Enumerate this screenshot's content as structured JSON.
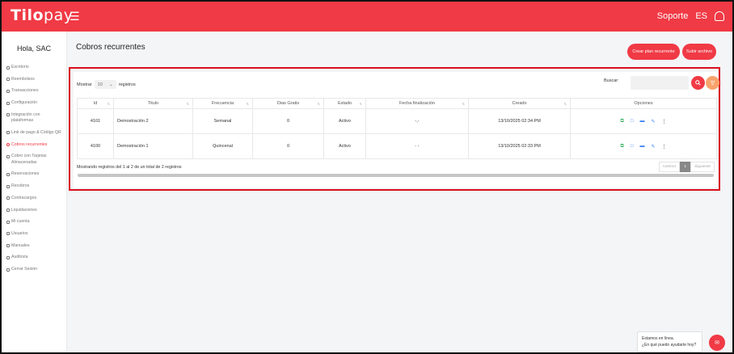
{
  "topbar": {
    "logo_bold": "Tilo",
    "logo_thin": "pay",
    "support": "Soporte",
    "lang": "ES"
  },
  "sidebar": {
    "greeting": "Hola, SAC",
    "items": [
      {
        "label": "Escritorio"
      },
      {
        "label": "Reembolsos"
      },
      {
        "label": "Transacciones"
      },
      {
        "label": "Configuración"
      },
      {
        "label": "Integración con plataformas"
      },
      {
        "label": "Link de pago & Código QR"
      },
      {
        "label": "Cobros recurrentes"
      },
      {
        "label": "Cobro con Tarjetas Almacenadas"
      },
      {
        "label": "Reservaciones"
      },
      {
        "label": "Recobros"
      },
      {
        "label": "Contracargos"
      },
      {
        "label": "Liquidaciones"
      },
      {
        "label": "Mi cuenta"
      },
      {
        "label": "Usuarios"
      },
      {
        "label": "Manuales"
      },
      {
        "label": "Auditoria"
      },
      {
        "label": "Cerrar Sesión"
      }
    ]
  },
  "main": {
    "title": "Cobros recurrentes",
    "btn_create": "Crear plan recurrente",
    "btn_upload": "Subir archivo"
  },
  "table": {
    "show_label": "Mostrar",
    "show_value": "10",
    "records_label": "registros",
    "search_label": "Buscar:",
    "headers": [
      "Id",
      "Titulo",
      "Frecuencia",
      "Dias Gratis",
      "Estado",
      "Fecha finalización",
      "Creado",
      "Opciones"
    ],
    "rows": [
      {
        "id": "4101",
        "title": "Demostración 2",
        "freq": "Semanal",
        "free": "0",
        "status": "Activo",
        "end": "-,-",
        "created": "13/10/2025 02:34 PM"
      },
      {
        "id": "4100",
        "title": "Demostración 1",
        "freq": "Quincenal",
        "free": "0",
        "status": "Activo",
        "end": "- -",
        "created": "13/10/2025 02:33 PM"
      }
    ],
    "footer": "Mostrando registros del 1 al 2 de un total de 2 registros",
    "prev": "Anterior",
    "page": "1",
    "next": "Siguiente"
  },
  "chat": {
    "line1": "Estamos en línea.",
    "line2": "¿En qué puedo ayudarte hoy?"
  },
  "colors": {
    "brand": "#f03a45",
    "highlight": "#d90f1c",
    "orange": "#f8a36b"
  }
}
